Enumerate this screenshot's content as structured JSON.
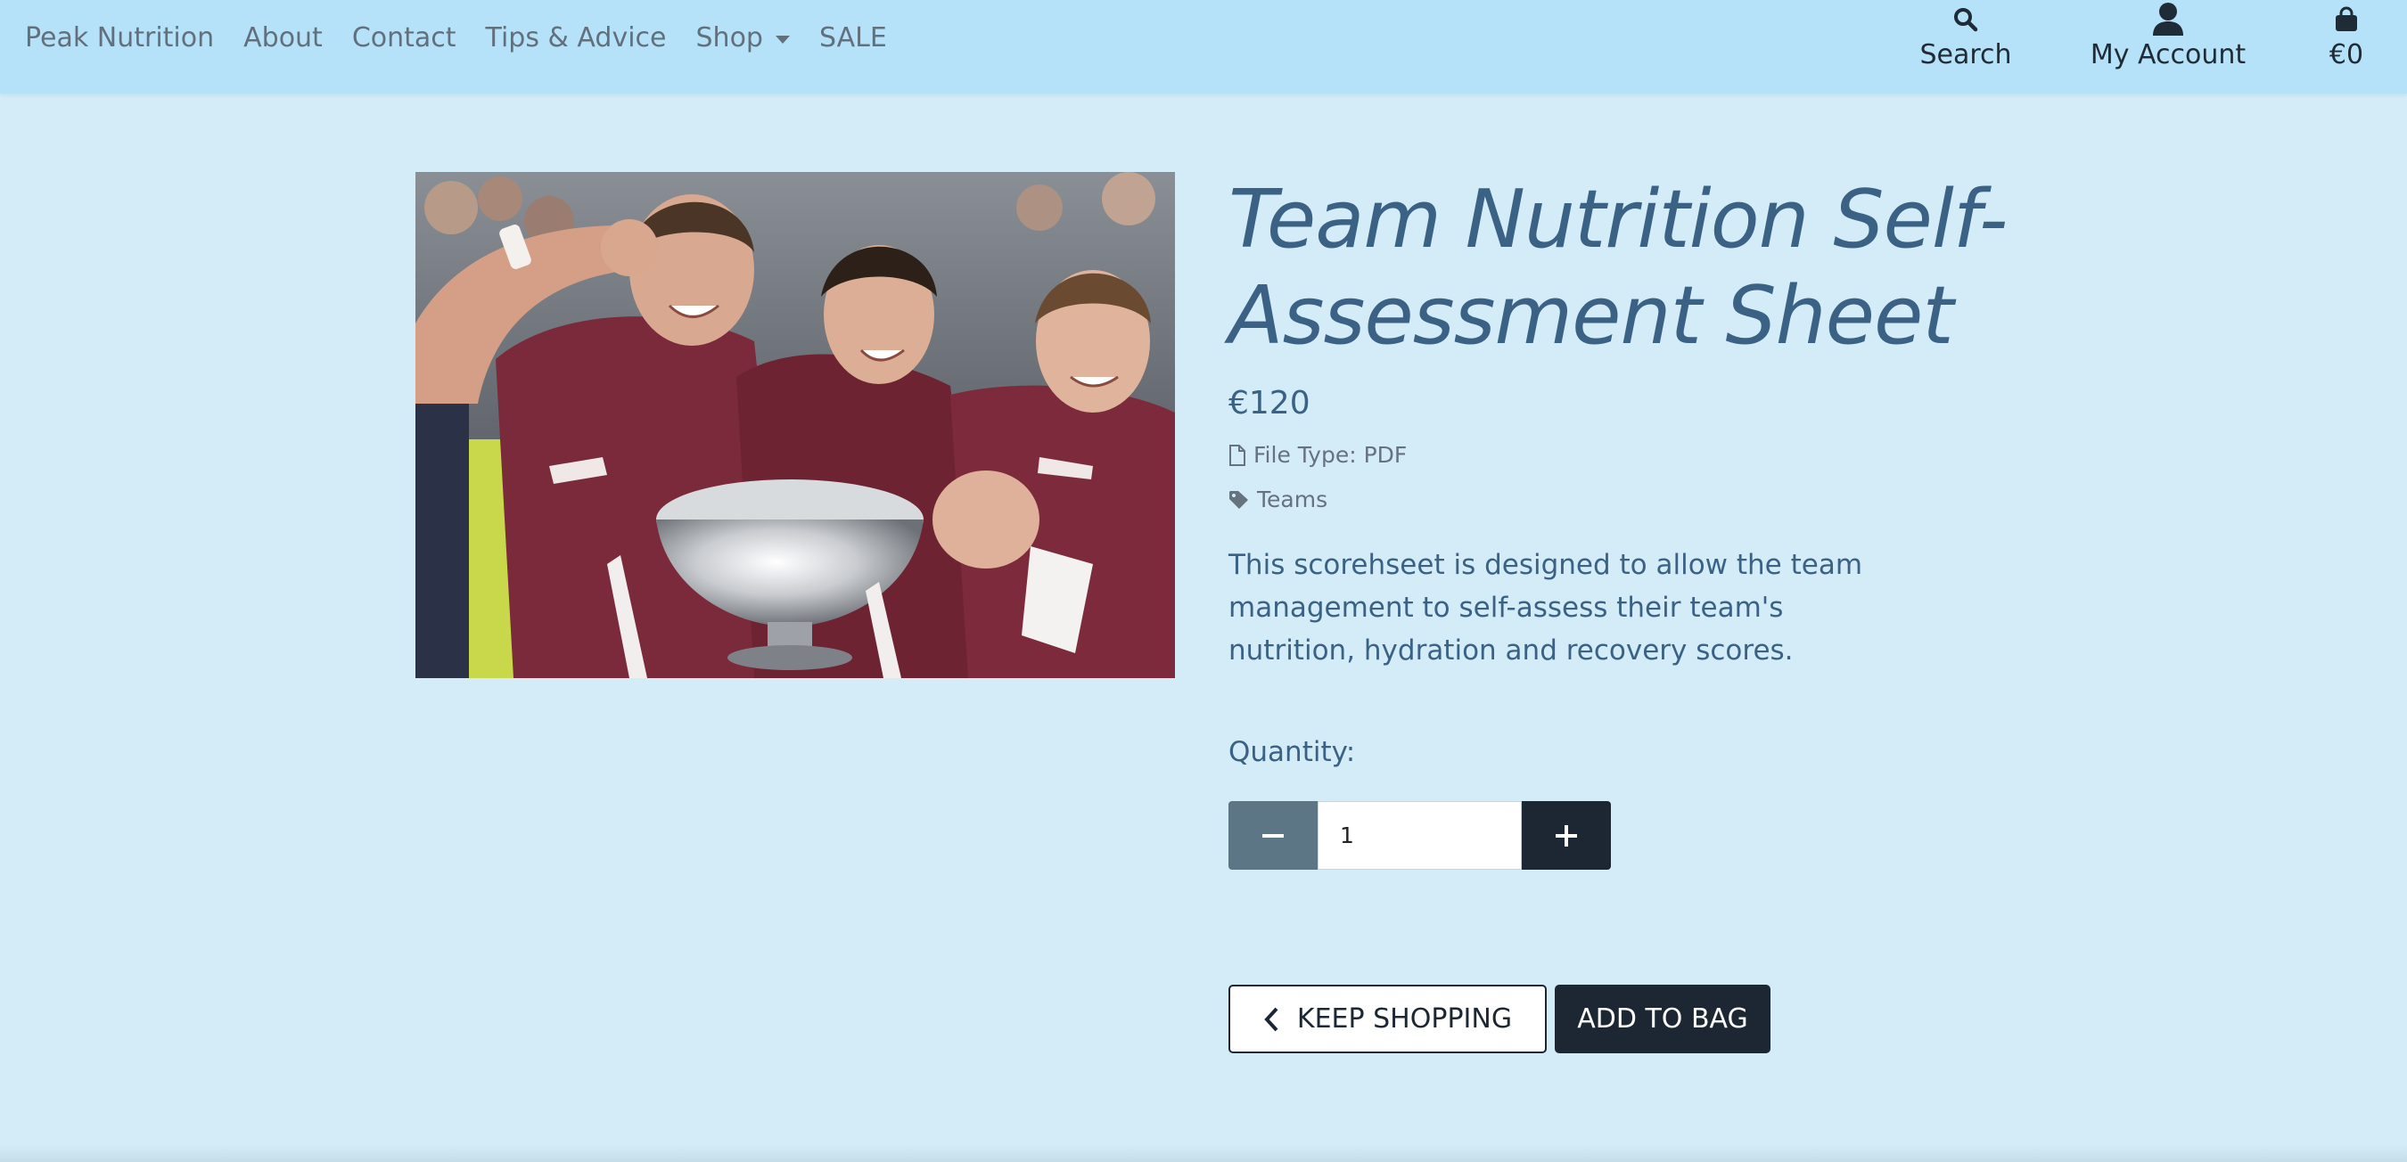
{
  "nav": {
    "brand": "Peak Nutrition",
    "links": [
      "About",
      "Contact",
      "Tips & Advice",
      "Shop",
      "SALE"
    ],
    "search_label": "Search",
    "account_label": "My Account",
    "bag_total": "€0"
  },
  "product": {
    "image_alt": "Team celebrating with trophy",
    "title": "Team Nutrition Self-Assessment Sheet",
    "price": "€120",
    "file_type": "File Type: PDF",
    "category": "Teams",
    "description": "This scorehseet is designed to allow the team management to self-assess their team's nutrition, hydration and recovery scores.",
    "quantity_label": "Quantity:",
    "quantity_value": "1",
    "keep_shopping_label": "KEEP SHOPPING",
    "add_to_bag_label": "ADD TO BAG"
  },
  "colors": {
    "page_bg": "#d3ecf8",
    "navbar_bg": "#b5e2f8",
    "heading": "#3b6284",
    "dark_button": "#1c2733",
    "minus_button": "#5d7686"
  }
}
